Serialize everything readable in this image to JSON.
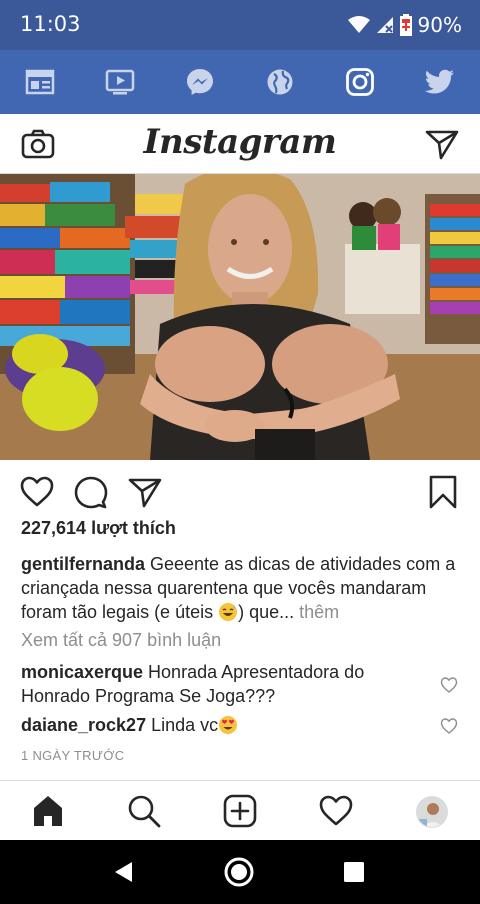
{
  "status_bar": {
    "time": "11:03",
    "battery": "90%"
  },
  "app_bar": {
    "icons": [
      "news-feed-icon",
      "watch-video-icon",
      "messenger-icon",
      "globe-icon",
      "instagram-icon",
      "twitter-icon"
    ],
    "background": "#4267b2"
  },
  "header": {
    "logo": "Instagram"
  },
  "post": {
    "likes": "227,614 lượt thích",
    "caption": {
      "user": "gentilfernanda",
      "text": " Geeente as dicas de atividades com a criançada nessa quarentena que vocês mandaram foram tão legais (e úteis ",
      "text_after": ") que...",
      "more": " thêm"
    },
    "view_all_comments": "Xem tất cả 907 bình luận",
    "comments": [
      {
        "user": "monicaxerque",
        "text": " Honrada Apresentadora do Honrado Programa Se Joga???"
      },
      {
        "user": "daiane_rock27",
        "text": " Linda vc"
      }
    ],
    "timestamp": "1 NGÀY TRƯỚC"
  },
  "bottom_nav": [
    "home-icon",
    "search-icon",
    "new-post-icon",
    "activity-heart-icon",
    "profile-avatar"
  ],
  "colors": {
    "facebook_blue": "#4267b2",
    "status_blue": "#3b5998",
    "muted_text": "#8e8e8e"
  }
}
